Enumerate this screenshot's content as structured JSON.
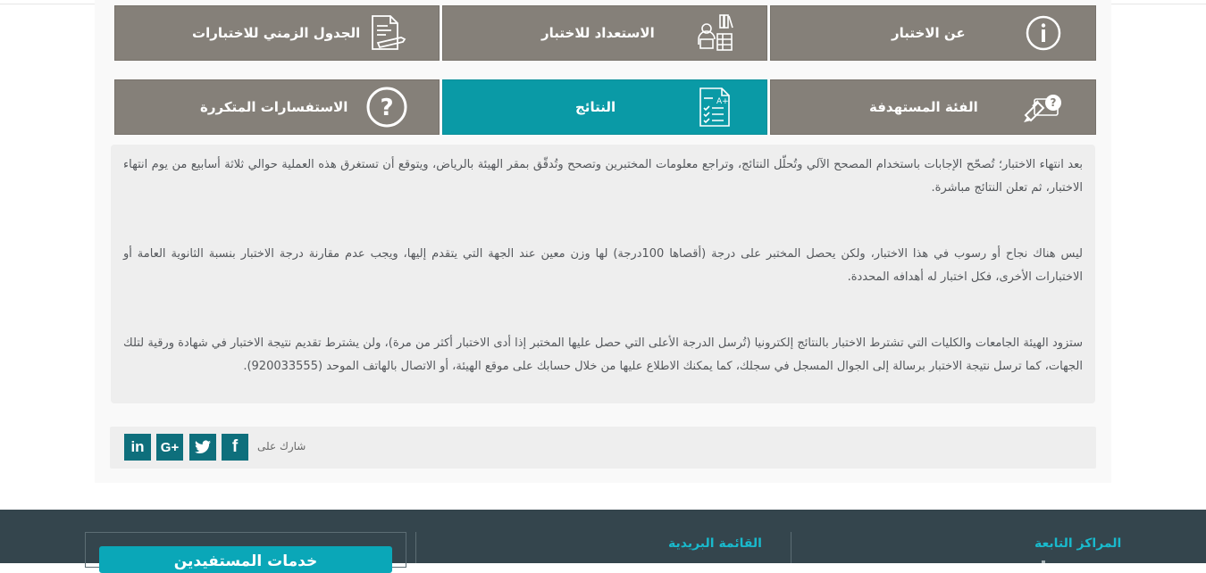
{
  "tiles": {
    "row1": [
      {
        "label": "عن الاختبار",
        "icon": "info-icon",
        "active": false
      },
      {
        "label": "الاستعداد للاختبار",
        "icon": "study-icon",
        "active": false
      },
      {
        "label": "الجدول الزمني للاختبارات",
        "icon": "document-pen-icon",
        "active": false
      }
    ],
    "row2": [
      {
        "label": "الفئة المستهدفة",
        "icon": "target-question-icon",
        "active": false
      },
      {
        "label": "النتائج",
        "icon": "results-checklist-icon",
        "active": true
      },
      {
        "label": "الاستفسارات المتكررة",
        "icon": "question-icon",
        "active": false
      }
    ]
  },
  "content": {
    "p1": "بعد انتهاء الاختبار؛ تُصحّح الإجابات باستخدام المصحح الآلي وتُحلّل النتائج، وتراجع معلومات المختبرين وتصحح وتُدقّق بمقر الهيئة بالرياض، ويتوقع أن تستغرق هذه العملية حوالي ثلاثة أسابيع من يوم انتهاء الاختبار، ثم تعلن النتائج مباشرة.",
    "p2": "ليس هناك نجاح أو رسوب في هذا الاختبار، ولكن يحصل المختبر على درجة (أقصاها 100درجة) لها وزن معين عند الجهة التي يتقدم إليها، ويجب عدم مقارنة درجة الاختبار بنسبة الثانوية العامة أو الاختبارات الأخرى، فكل اختبار له أهدافه المحددة.",
    "p3": "ستزود الهيئة الجامعات والكليات التي تشترط الاختبار بالنتائج إلكترونيا (تُرسل الدرجة الأعلى التي حصل عليها المختبر إذا أدى الاختبار أكثر من مرة)، ولن يشترط تقديم نتيجة الاختبار في شهادة ورقية لتلك الجهات، كما ترسل نتيجة الاختبار برسالة إلى الجوال المسجل في سجلك، كما يمكنك الاطلاع عليها من خلال حسابك على موقع الهيئة، أو الاتصال بالهاتف الموحد (920033555)."
  },
  "share": {
    "label": "شارك على",
    "buttons": [
      {
        "name": "facebook",
        "glyph": "f"
      },
      {
        "name": "twitter",
        "glyph": ""
      },
      {
        "name": "google-plus",
        "glyph": "G+"
      },
      {
        "name": "linkedin",
        "glyph": "in"
      }
    ]
  },
  "footer": {
    "services_button": "خدمات المستفيدين",
    "mailing_list": "القائمة البريدية",
    "affiliated_centers": "المراكز التابعة"
  },
  "colors": {
    "tile": "#858079",
    "tile_active": "#0a9aa6",
    "footer": "#34454d",
    "accent": "#19b9cc",
    "social": "#0e6f7c"
  }
}
